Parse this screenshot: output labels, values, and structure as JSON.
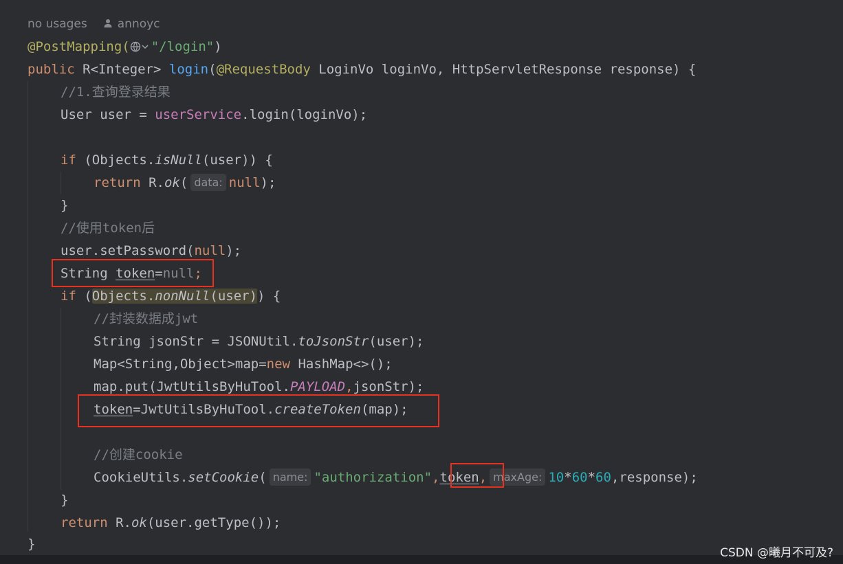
{
  "hint": {
    "usages": "no usages",
    "author": "annoyc"
  },
  "code": {
    "l1_annotation": "@PostMapping(",
    "l1_path": "\"/login\"",
    "l1_close": ")",
    "l2_public": "public",
    "l2_type": " R<Integer> ",
    "l2_method": "login",
    "l2_open": "(",
    "l2_ann": "@RequestBody",
    "l2_rest": " LoginVo loginVo, HttpServletResponse response) {",
    "l3_comment": "//1.查询登录结果",
    "l4_a": "User user = ",
    "l4_field": "userService",
    "l4_b": ".login(loginVo);",
    "l5_if": "if",
    "l5_a": " (Objects.",
    "l5_m": "isNull",
    "l5_b": "(user)) {",
    "l6_return": "return",
    "l6_a": " R.",
    "l6_m": "ok",
    "l6_b": "(",
    "l6_hint": "data:",
    "l6_null": "null",
    "l6_c": ");",
    "l7_brace": "}",
    "l8_comment": "//使用token后",
    "l9_a": "user.setPassword(",
    "l9_null": "null",
    "l9_b": ");",
    "l10_type": "String ",
    "l10_var": "token",
    "l10_eq": "=",
    "l10_null": "null",
    "l10_semi": ";",
    "l11_if": "if",
    "l11_a": " (",
    "l11_obj": "Objects.",
    "l11_m": "nonNull",
    "l11_b": "(user",
    "l11_c": ")",
    "l11_d": ") {",
    "l12_comment": "//封装数据成jwt",
    "l13_a": "String jsonStr = JSONUtil.",
    "l13_m": "toJsonStr",
    "l13_b": "(user);",
    "l14_a": "Map<String,Object>map=",
    "l14_new": "new",
    "l14_b": " HashMap<>();",
    "l15_a": "map.put(JwtUtilsByHuTool.",
    "l15_const": "PAYLOAD",
    "l15_comma": ",",
    "l15_b": "jsonStr);",
    "l16_var": "token",
    "l16_a": "=JwtUtilsByHuTool.",
    "l16_m": "createToken",
    "l16_b": "(map);",
    "l18_comment": "//创建cookie",
    "l19_a": "CookieUtils.",
    "l19_m": "setCookie",
    "l19_b": "(",
    "l19_hint1": "name:",
    "l19_str": "\"authorization\"",
    "l19_comma": ",",
    "l19_var": "token",
    "l19_comma2": ",",
    "l19_hint2": "maxAge:",
    "l19_n1": "10",
    "l19_op1": "*",
    "l19_n2": "60",
    "l19_op2": "*",
    "l19_n3": "60",
    "l19_c": ",response);",
    "l20_brace": "}",
    "l21_return": "return",
    "l21_a": " R.",
    "l21_m": "ok",
    "l21_b": "(user.getType());",
    "l22_brace": "}"
  },
  "watermark": "CSDN @曦月不可及?",
  "colors": {
    "background": "#2b2d30",
    "keyword": "#cf8e6d",
    "annotation": "#b3ae60",
    "string": "#6aab73",
    "method": "#56a8f5",
    "field": "#c77dbb",
    "comment": "#7a7e85",
    "number": "#2aacb8",
    "highlight_box": "#e8311e"
  }
}
